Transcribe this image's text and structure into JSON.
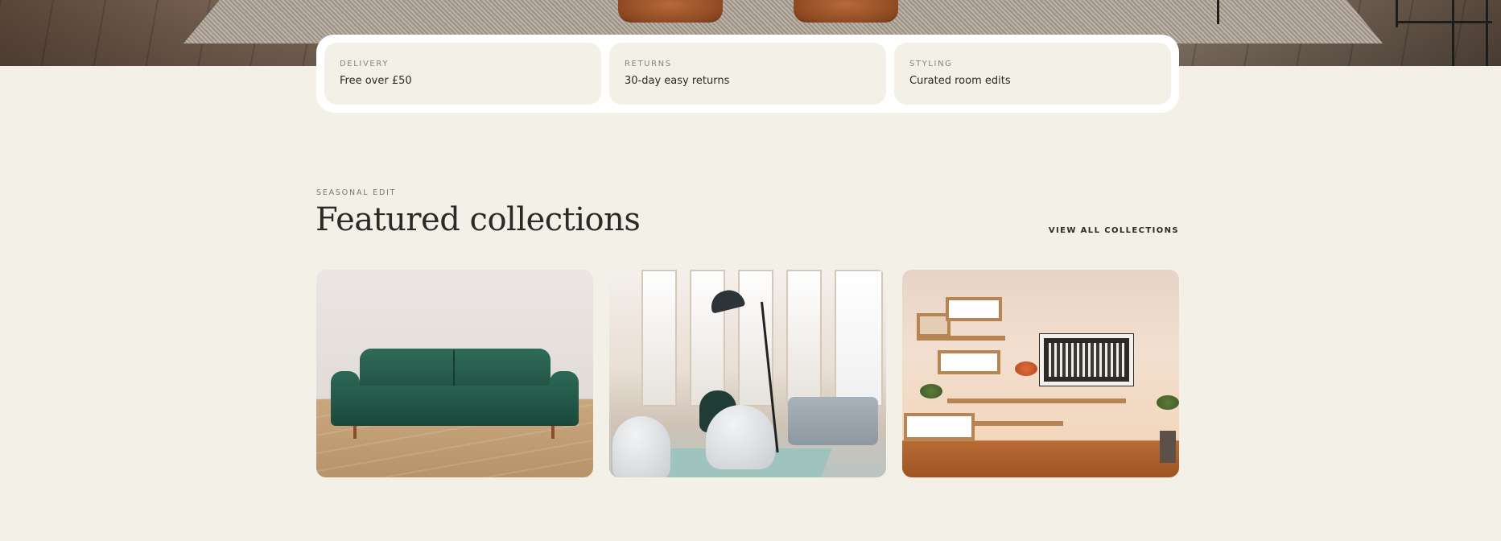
{
  "features": [
    {
      "label": "DELIVERY",
      "text": "Free over £50"
    },
    {
      "label": "RETURNS",
      "text": "30-day easy returns"
    },
    {
      "label": "STYLING",
      "text": "Curated room edits"
    }
  ],
  "section": {
    "eyebrow": "SEASONAL EDIT",
    "title": "Featured collections",
    "view_all": "VIEW ALL COLLECTIONS"
  },
  "colors": {
    "page_background": "#f3f0e8",
    "card_background": "#ffffff",
    "feature_tile": "#f3f0e8",
    "text_primary": "#2d2a26",
    "text_muted": "#8a857c"
  }
}
